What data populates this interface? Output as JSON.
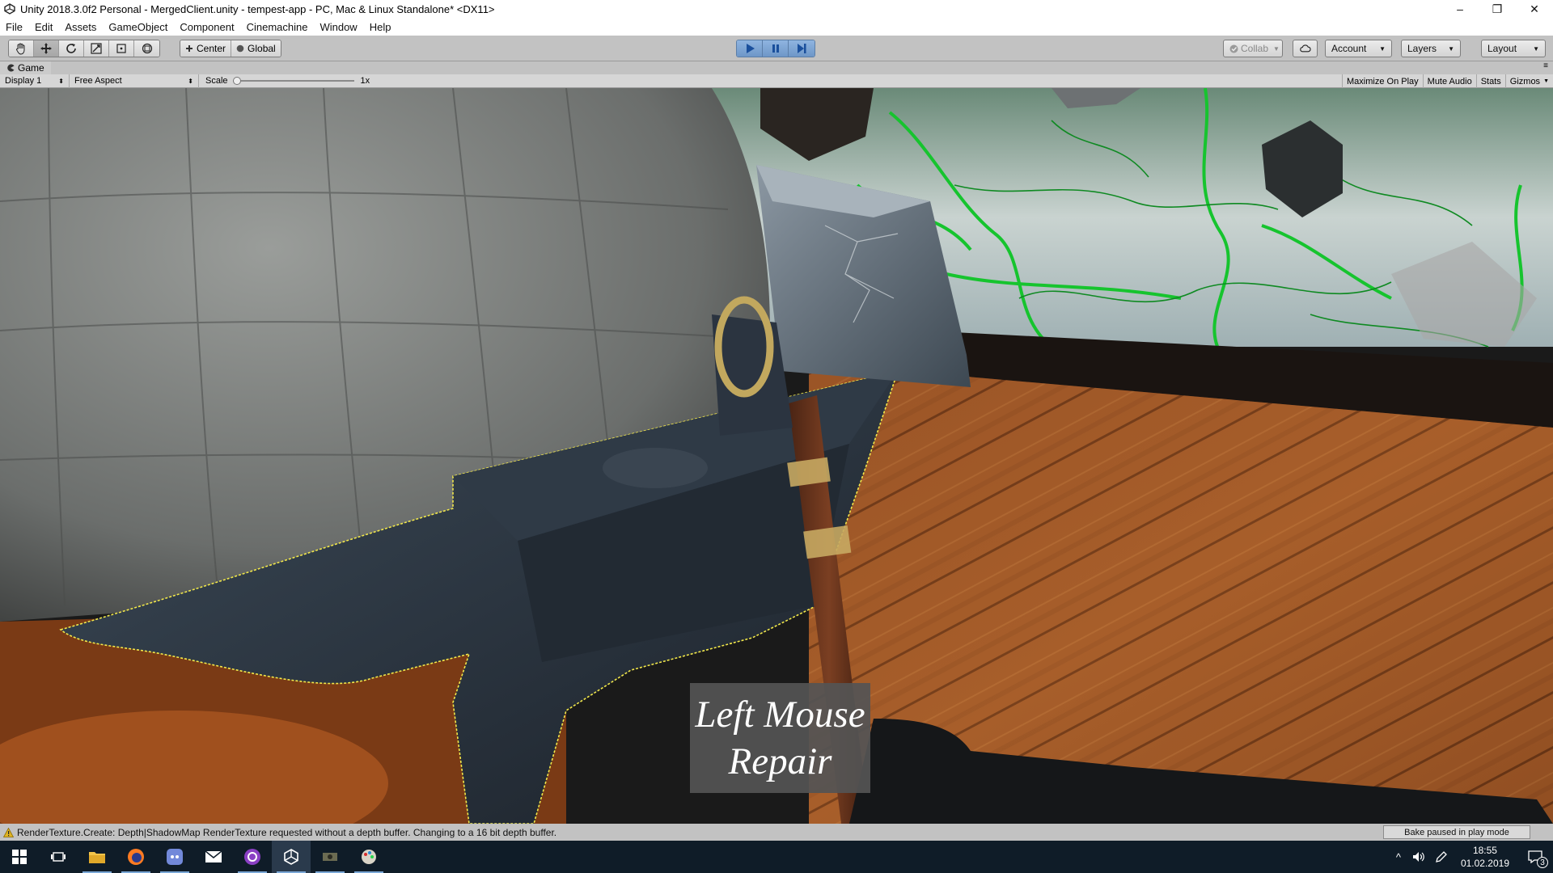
{
  "window": {
    "title": "Unity 2018.3.0f2 Personal - MergedClient.unity - tempest-app - PC, Mac & Linux Standalone* <DX11>",
    "controls": [
      "–",
      "❐",
      "✕"
    ]
  },
  "menu": [
    "File",
    "Edit",
    "Assets",
    "GameObject",
    "Component",
    "Cinemachine",
    "Window",
    "Help"
  ],
  "toolbar": {
    "tools": [
      "hand-tool",
      "move-tool",
      "rotate-tool",
      "scale-tool",
      "rect-tool",
      "transform-tool"
    ],
    "pivot": "Center",
    "space": "Global",
    "collab": "Collab",
    "account": "Account",
    "layers": "Layers",
    "layout": "Layout"
  },
  "game_view": {
    "tab": "Game",
    "display": "Display 1",
    "aspect": "Free Aspect",
    "scale_label": "Scale",
    "scale_value": "1x",
    "toggles": [
      "Maximize On Play",
      "Mute Audio",
      "Stats",
      "Gizmos"
    ]
  },
  "scene": {
    "prompt_line1": "Left Mouse",
    "prompt_line2": "Repair"
  },
  "status": {
    "message": "RenderTexture.Create: Depth|ShadowMap RenderTexture requested without a depth buffer. Changing to a 16 bit depth buffer.",
    "bake": "Bake paused in play mode"
  },
  "taskbar": {
    "time": "18:55",
    "date": "01.02.2019",
    "notifications": "3"
  }
}
